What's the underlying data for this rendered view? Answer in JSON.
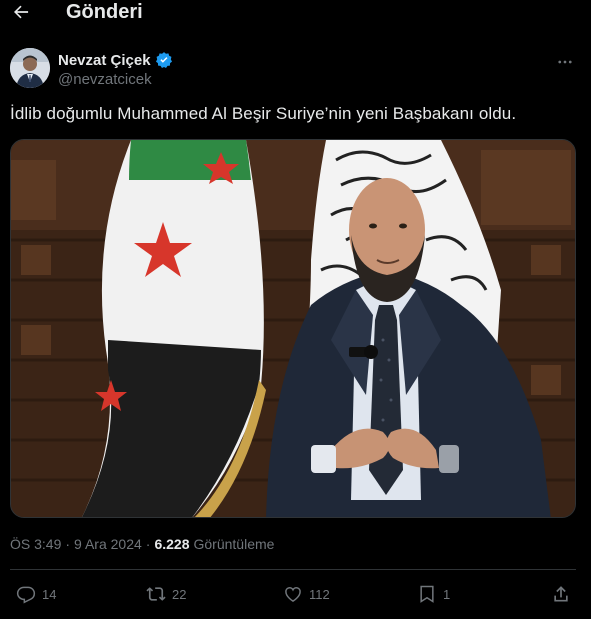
{
  "header": {
    "back_icon": "arrow-left-icon",
    "title": "Gönderi"
  },
  "author": {
    "display_name": "Nevzat Çiçek",
    "handle": "@nevzatcicek",
    "verified_icon": "verified-badge-icon",
    "more_icon": "more-horizontal-icon"
  },
  "tweet": {
    "text": "İdlib doğumlu Muhammed Al Beşir Suriye’nin yeni Başbakanı oldu."
  },
  "meta": {
    "time": "ÖS 3:49",
    "separator": "·",
    "date": "9 Ara 2024",
    "views_count": "6.228",
    "views_label": "Görüntüleme"
  },
  "actions": {
    "replies": "14",
    "reposts": "22",
    "likes": "112",
    "bookmarks": "1"
  },
  "colors": {
    "background": "#000000",
    "text": "#e7e9ea",
    "muted": "#71767b",
    "verified": "#1d9bf0",
    "border": "#2f3336"
  }
}
